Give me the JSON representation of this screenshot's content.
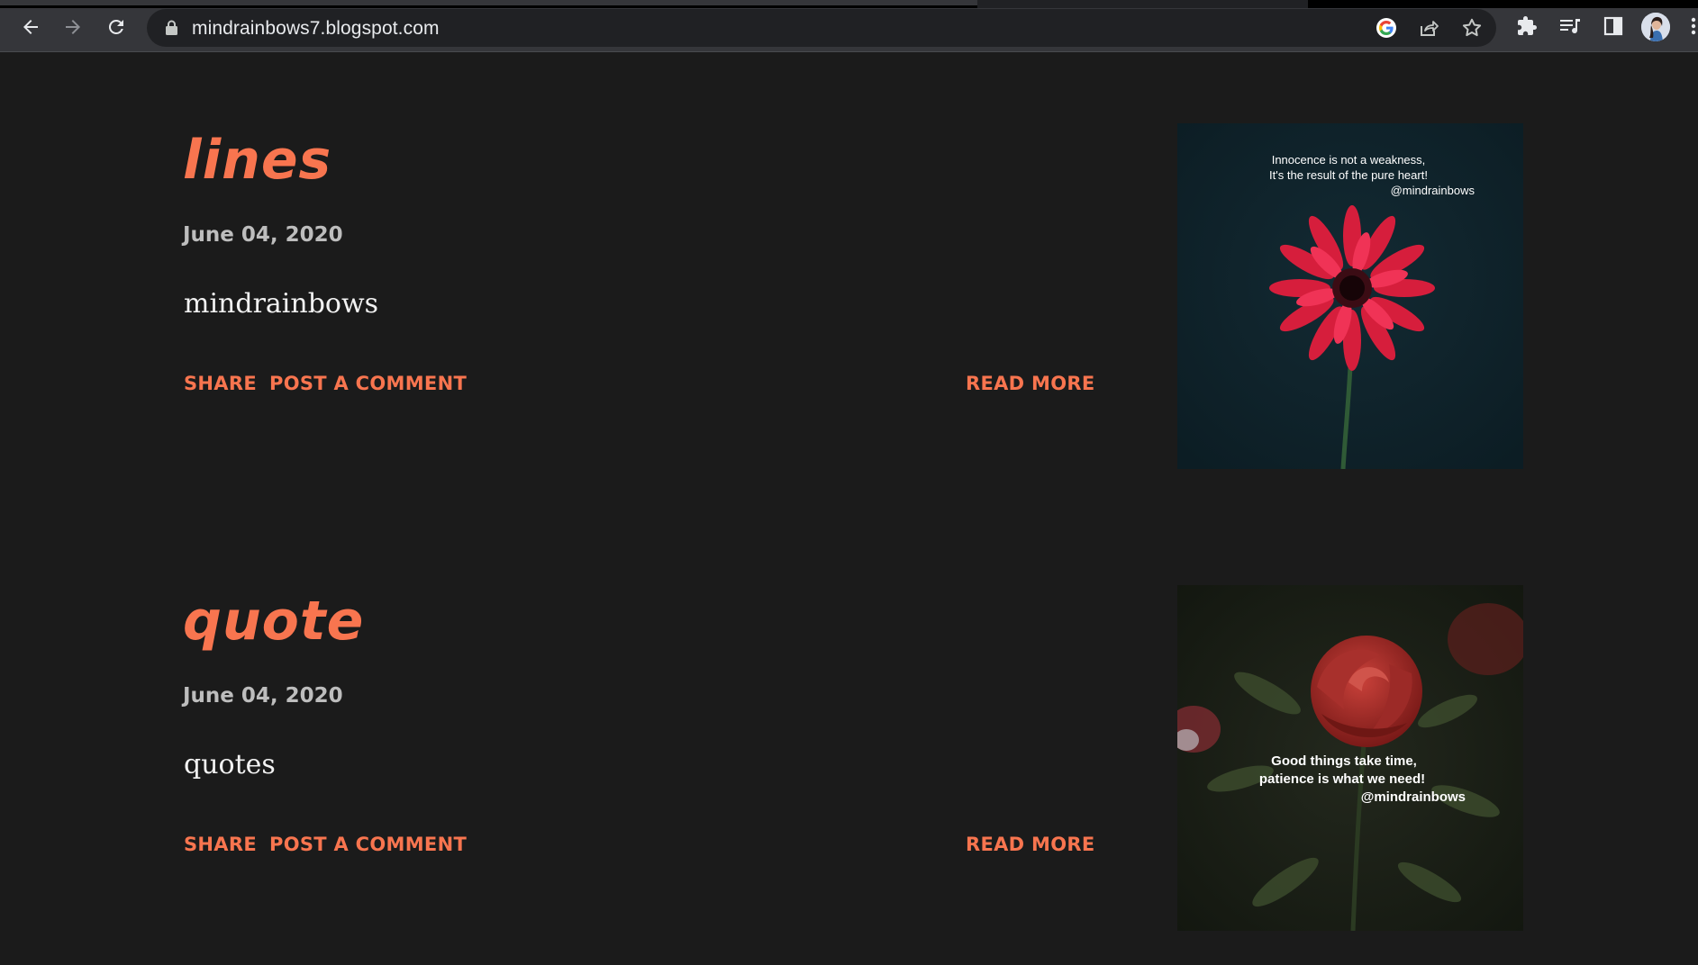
{
  "browser": {
    "url": "mindrainbows7.blogspot.com",
    "icons": [
      "back-icon",
      "forward-icon",
      "reload-icon",
      "lock-icon",
      "google-icon",
      "share-icon",
      "star-icon",
      "extensions-icon",
      "media-icon",
      "side-panel-icon",
      "profile-avatar",
      "menu-icon"
    ]
  },
  "colors": {
    "accent": "#f8754f",
    "background": "#1b1b1b",
    "date": "#bdbdbd",
    "text": "#f2f2f2"
  },
  "posts": [
    {
      "title": "lines",
      "date": "June 04, 2020",
      "snippet": "mindrainbows",
      "share": "SHARE",
      "comment": "POST A COMMENT",
      "read_more": "READ MORE",
      "image": {
        "line1": "Innocence is not a weakness,",
        "line2": "It's the result of the pure heart!",
        "handle": "@mindrainbows"
      }
    },
    {
      "title": "quote",
      "date": "June 04, 2020",
      "snippet": "quotes",
      "share": "SHARE",
      "comment": "POST A COMMENT",
      "read_more": "READ MORE",
      "image": {
        "line1": "Good things take time,",
        "line2": "patience is what we need!",
        "handle": "@mindrainbows"
      }
    }
  ]
}
